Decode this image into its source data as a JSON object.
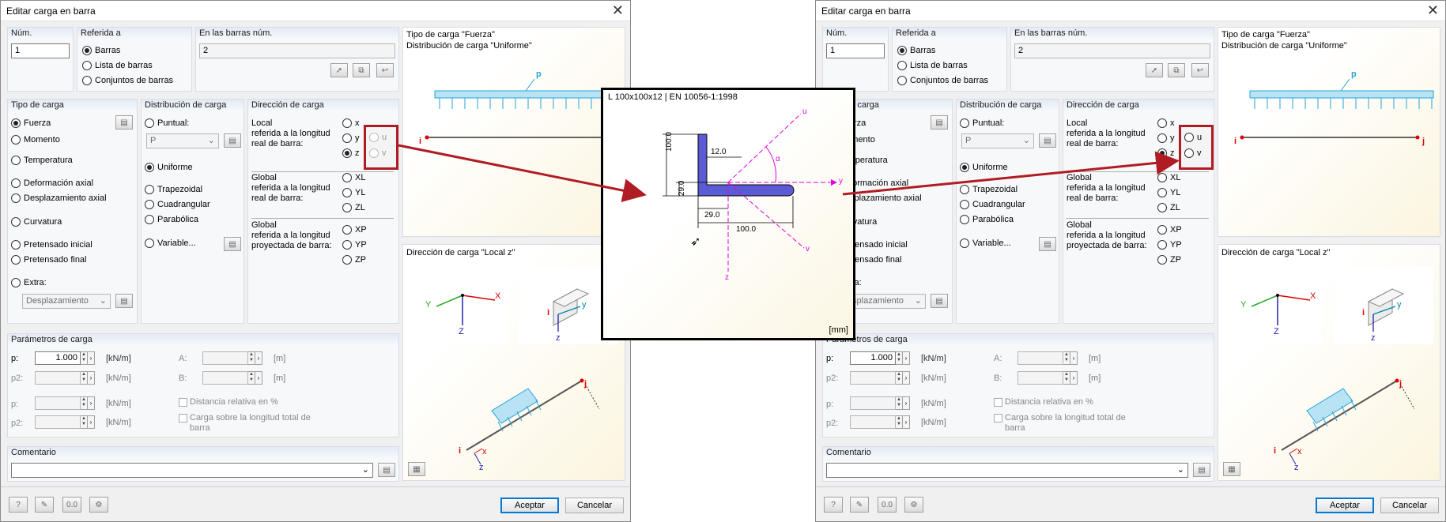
{
  "dialog": {
    "title": "Editar carga en barra",
    "num_label": "Núm.",
    "num_value": "1",
    "referida": {
      "title": "Referida a",
      "options": [
        "Barras",
        "Lista de barras",
        "Conjuntos de barras"
      ],
      "selected": 0
    },
    "barras": {
      "title": "En las barras núm.",
      "value": "2"
    },
    "info": {
      "line1": "Tipo de carga \"Fuerza\"",
      "line2": "Distribución de carga \"Uniforme\""
    },
    "diagram_labels": {
      "p": "p",
      "i": "i",
      "j": "j"
    },
    "tipo": {
      "title": "Tipo de carga",
      "options": [
        "Fuerza",
        "Momento",
        "Temperatura",
        "Deformación axial",
        "Desplazamiento axial",
        "Curvatura",
        "Pretensado inicial",
        "Pretensado final",
        "Extra:"
      ],
      "selected": 0,
      "extra_value": "Desplazamiento"
    },
    "distribucion": {
      "title": "Distribución de carga",
      "options": [
        "Puntual:",
        "Uniforme",
        "Trapezoidal",
        "Cuadrangular",
        "Parabólica",
        "Variable..."
      ],
      "selected": 1,
      "puntual_value": "P"
    },
    "direccion": {
      "title": "Dirección de carga",
      "local_label": "Local\nreferida a la longitud\nreal de barra:",
      "local_options": [
        "x",
        "y",
        "z",
        "u",
        "v"
      ],
      "local_selected": 2,
      "global_label": "Global\nreferida a la longitud\nreal de barra:",
      "global_options": [
        "XL",
        "YL",
        "ZL"
      ],
      "proj_label": "Global\nreferida a la longitud\nproyectada de barra:",
      "proj_options": [
        "XP",
        "YP",
        "ZP"
      ]
    },
    "direction_panel": {
      "title": "Dirección de carga \"Local z\"",
      "axes_global": {
        "x": "X",
        "y": "Y",
        "z": "Z"
      },
      "axes_local": {
        "i": "i",
        "y": "y",
        "z": "z"
      },
      "member": {
        "i": "i",
        "j": "j",
        "x": "x",
        "z": "z"
      }
    },
    "parametros": {
      "title": "Parámetros de carga",
      "p_label": "p:",
      "p_value": "1.000",
      "p_unit": "[kN/m]",
      "p2_label": "p2:",
      "p2_unit": "[kN/m]",
      "p_b_label": "p:",
      "p_b_unit": "[kN/m]",
      "p2_b_label": "p2:",
      "p2_b_unit": "[kN/m]",
      "a_label": "A:",
      "a_unit": "[m]",
      "b_label": "B:",
      "b_unit": "[m]",
      "dist_rel": "Distancia relativa en %",
      "carga_total": "Carga sobre la longitud total de\nbarra"
    },
    "comentario": {
      "title": "Comentario",
      "value": ""
    },
    "buttons": {
      "ok": "Aceptar",
      "cancel": "Cancelar"
    },
    "toolbar_icons": [
      "help-icon",
      "edit-icon",
      "numeric-icon",
      "units-icon"
    ]
  },
  "popup": {
    "title": "L 100x100x12 | EN 10056-1:1998",
    "unit": "[mm]",
    "dims": {
      "height": "100.0",
      "width": "100.0",
      "thickness": "12.0",
      "ey": "29.0",
      "ez": "29.0"
    },
    "axes": {
      "u": "u",
      "v": "v",
      "y": "y",
      "z": "z",
      "alpha": "α"
    }
  },
  "colors": {
    "accent": "#0078d7",
    "callout": "#b01c24",
    "load": "#29a3d9",
    "axis_magenta": "#e000e0",
    "section_fill": "#5b5bd6"
  }
}
